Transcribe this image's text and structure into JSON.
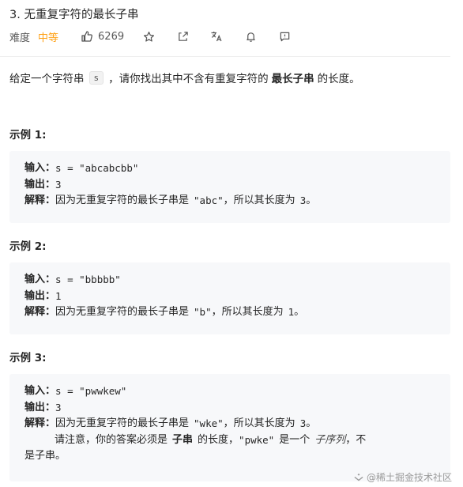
{
  "problem": {
    "title": "3. 无重复字符的最长子串",
    "difficulty_label": "难度",
    "difficulty_value": "中等",
    "likes": "6269"
  },
  "description": {
    "prefix": "给定一个字符串",
    "var": "s",
    "middle": "，请你找出其中不含有重复字符的",
    "bold": "最长子串",
    "suffix": "的长度。"
  },
  "examples": [
    {
      "title": "示例 1:",
      "input_label": "输入：",
      "input_value": "s = \"abcabcbb\"",
      "output_label": "输出：",
      "output_value": "3",
      "explain_label": "解释：",
      "explain_text": "因为无重复字符的最长子串是",
      "explain_code": "\"abc\"",
      "explain_mid": "，所以其长度为",
      "explain_num": "3",
      "explain_end": "。"
    },
    {
      "title": "示例 2:",
      "input_label": "输入：",
      "input_value": "s = \"bbbbb\"",
      "output_label": "输出：",
      "output_value": "1",
      "explain_label": "解释：",
      "explain_text": "因为无重复字符的最长子串是",
      "explain_code": "\"b\"",
      "explain_mid": "，所以其长度为",
      "explain_num": "1",
      "explain_end": "。"
    },
    {
      "title": "示例 3:",
      "input_label": "输入：",
      "input_value": "s = \"pwwkew\"",
      "output_label": "输出：",
      "output_value": "3",
      "explain_label": "解释：",
      "explain_text": "因为无重复字符的最长子串是",
      "explain_code": "\"wke\"",
      "explain_mid": "，所以其长度为",
      "explain_num": "3",
      "explain_end": "。",
      "note_prefix": "请注意，你的答案必须是",
      "note_bold": "子串",
      "note_mid": "的长度，",
      "note_code": "\"pwke\"",
      "note_is": "是一个",
      "note_term": "子序列",
      "note_end": "，不",
      "note_wrap": "是子串。"
    }
  ],
  "watermark": "@稀土掘金技术社区",
  "icons": {
    "like": "thumb-up-icon",
    "star": "star-icon",
    "share": "share-icon",
    "translate": "translate-icon",
    "bell": "bell-icon",
    "feedback": "feedback-icon"
  },
  "colors": {
    "difficulty": "#ffa116",
    "code_bg": "#f7f8fa",
    "text": "#262626"
  }
}
